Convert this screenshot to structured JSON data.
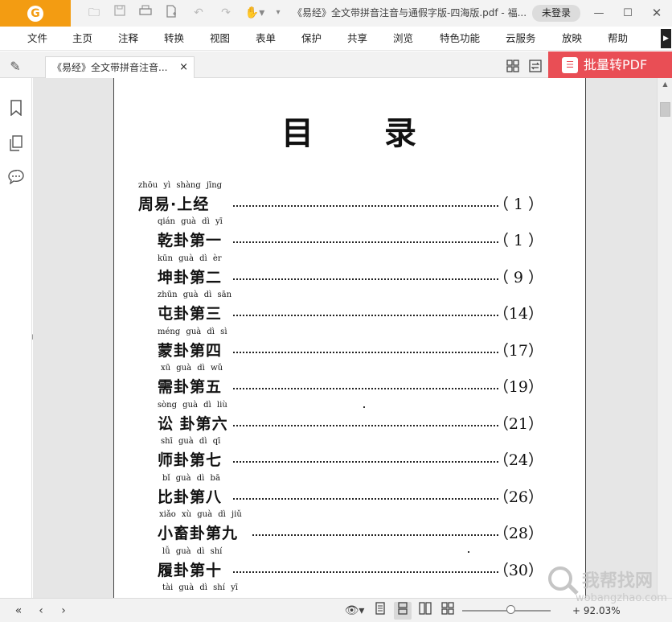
{
  "app": {
    "logo_letter": "G",
    "doc_title": "《易经》全文带拼音注音与通假字版-四海版.pdf - 福...",
    "login_label": "未登录",
    "window_controls": [
      "minimize-icon",
      "maximize-icon",
      "close-icon"
    ]
  },
  "quick_access": [
    "open-folder-icon",
    "save-icon",
    "print-icon",
    "new-page-icon",
    "undo-icon",
    "redo-icon",
    "hand-tool-icon",
    "customize-dropdown-icon"
  ],
  "menu": [
    "文件",
    "主页",
    "注释",
    "转换",
    "视图",
    "表单",
    "保护",
    "共享",
    "浏览",
    "特色功能",
    "云服务",
    "放映",
    "帮助"
  ],
  "tab": {
    "label": "《易经》全文带拼音注音...",
    "close": "×"
  },
  "convert_button": "批量转PDF",
  "sidebar_icons": [
    "bookmark-icon",
    "pages-icon",
    "comment-icon"
  ],
  "document": {
    "title_chars": [
      "目",
      "录"
    ],
    "toc": [
      {
        "pinyin": "zhōu yì  shàng jīng",
        "label": "周易·上经",
        "page": "（ 1 ）",
        "level": 0
      },
      {
        "pinyin": "qián guà  dì  yī",
        "label": "乾卦第一",
        "page": "（ 1 ）",
        "level": 1
      },
      {
        "pinyin": "kūn guà  dì  èr",
        "label": "坤卦第二",
        "page": "（ 9 ）",
        "level": 1
      },
      {
        "pinyin": "zhūn guà  dì  sān",
        "label": "屯卦第三",
        "page": "（14）",
        "level": 1
      },
      {
        "pinyin": "méng guà  dì  sì",
        "label": "蒙卦第四",
        "page": "（17）",
        "level": 1
      },
      {
        "pinyin": "xū  guà  dì  wǔ",
        "label": "需卦第五",
        "page": "（19）",
        "level": 1
      },
      {
        "pinyin": "sòng  guà  dì  liù",
        "label": "讼 卦第六",
        "page": "（21）",
        "level": 1
      },
      {
        "pinyin": "shī  guà  dì  qī",
        "label": "师卦第七",
        "page": "（24）",
        "level": 1
      },
      {
        "pinyin": "bǐ  guà  dì  bā",
        "label": "比卦第八",
        "page": "（26）",
        "level": 1
      },
      {
        "pinyin": "xiǎo  xù  guà  dì  jiǔ",
        "label": "小畜卦第九",
        "page": "（28）",
        "level": 1
      },
      {
        "pinyin": "lǚ  guà  dì  shí",
        "label": "履卦第十",
        "page": "（30）",
        "level": 1
      },
      {
        "pinyin": "tài  guà  dì  shí  yī",
        "label": "",
        "page": "",
        "level": 1
      }
    ]
  },
  "status": {
    "nav_buttons": [
      "first-page-icon",
      "prev-page-icon",
      "next-page-icon"
    ],
    "view_buttons": [
      "eye-mode-icon",
      "single-page-icon",
      "continuous-page-icon",
      "two-page-icon",
      "two-continuous-icon"
    ],
    "zoom": "92.03%"
  },
  "watermark": {
    "cn": "我帮找网",
    "en": "wobangzhao.com"
  },
  "colors": {
    "logo_orange": "#f39c12",
    "convert_red": "#e94e55",
    "page_bg": "#ffffff",
    "workspace_gray": "#e6e6e6"
  }
}
